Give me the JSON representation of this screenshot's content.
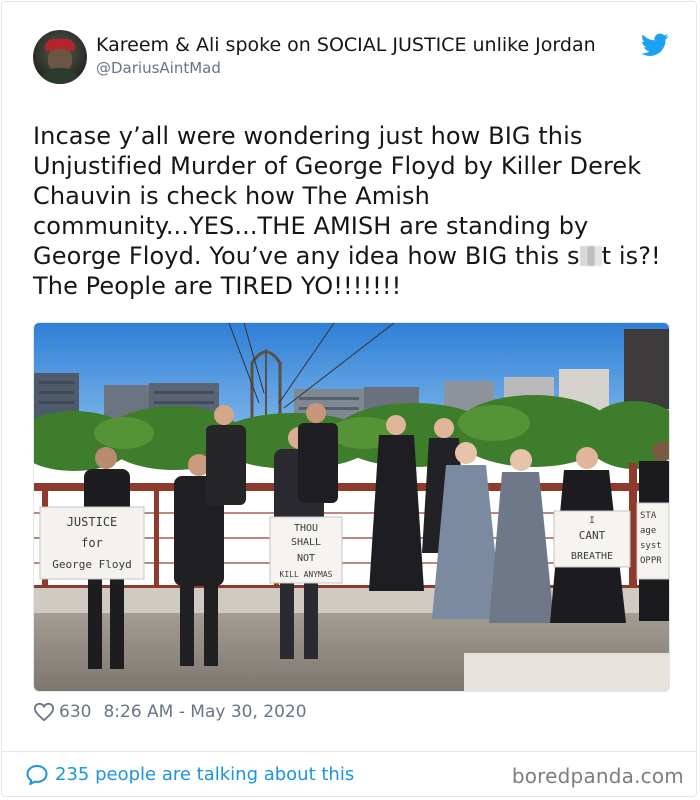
{
  "tweet": {
    "display_name": "Kareem & Ali spoke on SOCIAL JUSTICE unlike Jordan",
    "handle": "@DariusAintMad",
    "text_lines": [
      "Incase y’all were wondering just how BIG this",
      "Unjustified Murder of George Floyd by Killer Derek",
      "Chauvin is check how The Amish",
      "community...YES...THE AMISH are standing by"
    ],
    "line5_before": "George Floyd. You’ve any idea how BIG this s",
    "line5_after": "t is?!",
    "line6": "The People are TIRED YO!!!!!!!",
    "like_count": "630",
    "timestamp": "8:26 AM - May 30, 2020"
  },
  "media": {
    "sign_1": [
      "JUSTICE",
      "for",
      "George Floyd"
    ],
    "sign_2": [
      "THOU",
      "SHALL",
      "NOT",
      "KILL ANYMAS"
    ],
    "sign_3": [
      "I",
      "CANT",
      "BREATHE"
    ],
    "sign_4": [
      "STA",
      "age",
      "syst",
      "OPPR"
    ]
  },
  "footer": {
    "talking_text": "235 people are talking about this",
    "watermark": "boredpanda.com"
  },
  "colors": {
    "twitter_blue": "#1da1f2",
    "link_blue": "#1b95e0",
    "muted_gray": "#657786"
  },
  "icons": {
    "brand": "twitter-bird-icon",
    "like": "heart-outline-icon",
    "talk": "speech-bubble-icon"
  }
}
